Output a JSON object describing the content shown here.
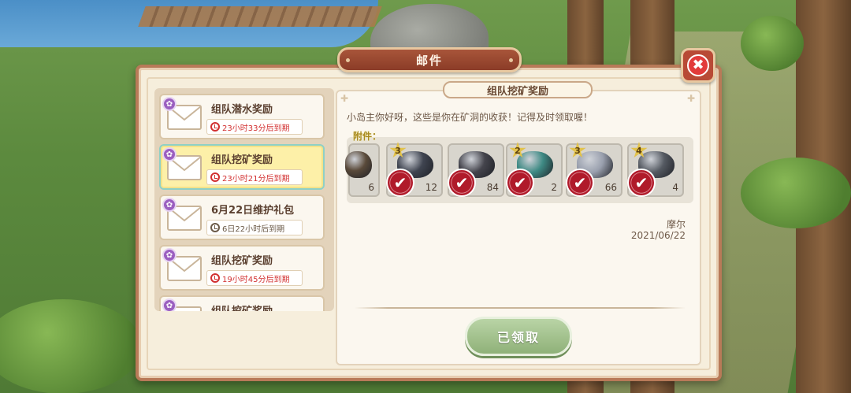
{
  "window": {
    "title": "邮件"
  },
  "close": {
    "label": "✖"
  },
  "mails": [
    {
      "title": "组队潜水奖励",
      "expire": "23小时33分后到期",
      "urgent": true
    },
    {
      "title": "组队挖矿奖励",
      "expire": "23小时21分后到期",
      "urgent": true,
      "selected": true
    },
    {
      "title": "6月22日维护礼包",
      "expire": "6日22小时后到期",
      "urgent": false
    },
    {
      "title": "组队挖矿奖励",
      "expire": "19小时45分后到期",
      "urgent": true
    },
    {
      "title": "组队挖矿奖励",
      "expire": "",
      "urgent": false
    }
  ],
  "detail": {
    "title": "组队挖矿奖励",
    "body": "小岛主你好呀，这些是你在矿洞的收获！记得及时领取喔！",
    "attachments_label": "附件：",
    "attachments": [
      {
        "count": "6",
        "star": "",
        "color": "#5a4a3a"
      },
      {
        "count": "12",
        "star": "3",
        "color": "#3f4450"
      },
      {
        "count": "84",
        "star": "",
        "color": "#44444c"
      },
      {
        "count": "2",
        "star": "2",
        "color": "#3e8a84"
      },
      {
        "count": "66",
        "star": "3",
        "color": "#9aa0ae"
      },
      {
        "count": "4",
        "star": "4",
        "color": "#555a62"
      }
    ],
    "sender": "摩尔",
    "date": "2021/06/22",
    "button_label": "已领取"
  },
  "colors": {
    "accent": "#a8553a",
    "expire_red": "#d23030",
    "claimed_green": "#8fb178"
  },
  "icons": {
    "envelope": "envelope-icon",
    "clock": "alarm-clock-icon",
    "check": "check-mark-icon",
    "close": "close-icon",
    "star": "star-rank-icon"
  }
}
